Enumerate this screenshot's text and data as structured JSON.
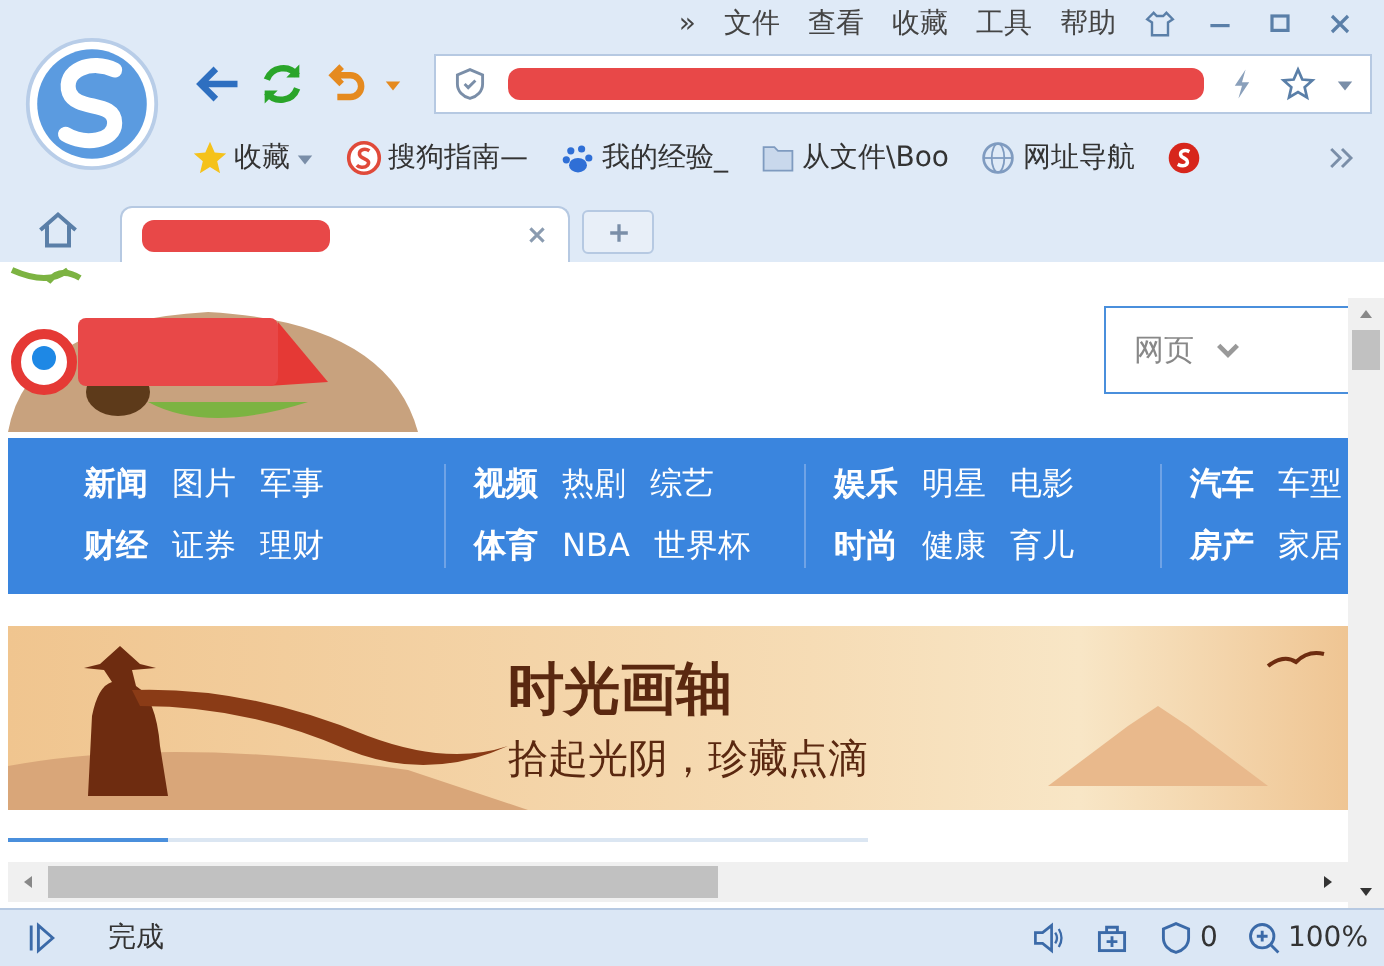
{
  "menu": [
    "»",
    "文件",
    "查看",
    "收藏",
    "工具",
    "帮助"
  ],
  "bookmarks": [
    {
      "label": "收藏",
      "kind": "favorites"
    },
    {
      "label": "搜狗指南—",
      "kind": "sogou"
    },
    {
      "label": "我的经验_",
      "kind": "paw"
    },
    {
      "label": "从文件\\Boo",
      "kind": "folder"
    },
    {
      "label": "网址导航",
      "kind": "globe"
    }
  ],
  "search": {
    "scope": "网页"
  },
  "nav_groups": [
    {
      "rows": [
        {
          "lead": "新闻",
          "items": [
            "图片",
            "军事"
          ]
        },
        {
          "lead": "财经",
          "items": [
            "证券",
            "理财"
          ]
        }
      ]
    },
    {
      "rows": [
        {
          "lead": "视频",
          "items": [
            "热剧",
            "综艺"
          ]
        },
        {
          "lead": "体育",
          "items": [
            "NBA",
            "世界杯"
          ]
        }
      ]
    },
    {
      "rows": [
        {
          "lead": "娱乐",
          "items": [
            "明星",
            "电影"
          ]
        },
        {
          "lead": "时尚",
          "items": [
            "健康",
            "育儿"
          ]
        }
      ]
    },
    {
      "rows": [
        {
          "lead": "汽车",
          "items": [
            "车型"
          ]
        },
        {
          "lead": "房产",
          "items": [
            "家居"
          ]
        }
      ]
    }
  ],
  "banner": {
    "title": "时光画轴",
    "subtitle": "拾起光阴，珍藏点滴"
  },
  "status_bar": {
    "text": "完成",
    "blocked": "0",
    "zoom": "100%"
  }
}
